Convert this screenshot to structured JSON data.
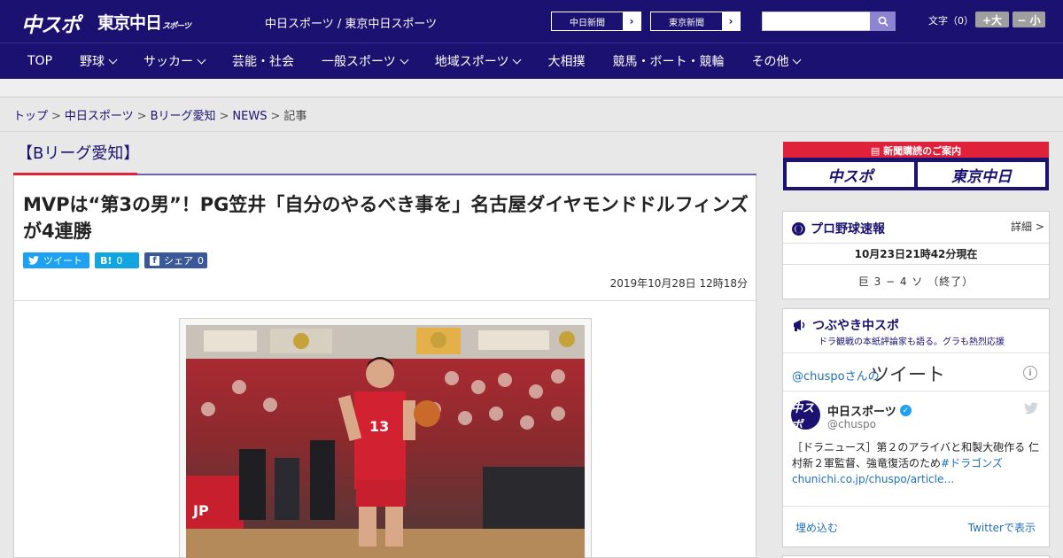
{
  "header": {
    "logo_chuspo": "中スポ",
    "logo_tokyo": "東京中日",
    "logo_tokyo_sub": "スポーツ",
    "site_title": "中日スポーツ / 東京中日スポーツ",
    "links": [
      {
        "label": "中日新聞"
      },
      {
        "label": "東京新聞"
      }
    ],
    "search": {
      "placeholder": "",
      "icon": "search-icon"
    },
    "font_size": {
      "label": "文字（0）",
      "bigger": "+大",
      "smaller": "− 小"
    }
  },
  "nav": {
    "items": [
      {
        "label": "TOP",
        "has_menu": false
      },
      {
        "label": "野球",
        "has_menu": true
      },
      {
        "label": "サッカー",
        "has_menu": true
      },
      {
        "label": "芸能・社会",
        "has_menu": false
      },
      {
        "label": "一般スポーツ",
        "has_menu": true
      },
      {
        "label": "地域スポーツ",
        "has_menu": true
      },
      {
        "label": "大相撲",
        "has_menu": false
      },
      {
        "label": "競馬・ボート・競輪",
        "has_menu": false
      },
      {
        "label": "その他",
        "has_menu": true
      }
    ]
  },
  "breadcrumb": {
    "items": [
      "トップ",
      "中日スポーツ",
      "Bリーグ愛知",
      "NEWS"
    ],
    "current": "記事",
    "separator": ">"
  },
  "article": {
    "section": "【Bリーグ愛知】",
    "title": "MVPは“第3の男”！PG笠井「自分のやるべき事を」名古屋ダイヤモンドドルフィンズが4連勝",
    "share": {
      "tweet": "ツイート",
      "hatena_icon": "B!",
      "hatena_count": "0",
      "facebook_icon": "f",
      "facebook_label": "シェア",
      "facebook_count": "0"
    },
    "date": "2019年10月28日 12時18分",
    "photo": {
      "player_number": "13"
    }
  },
  "sidebar": {
    "subscribe": {
      "title": "新聞購読のご案内",
      "left": "中スポ",
      "right": "東京中日"
    },
    "baseball": {
      "title": "プロ野球速報",
      "detail": "詳細 >",
      "time": "10月23日21時42分現在",
      "score": "巨 3 − 4 ソ （終了）"
    },
    "twitter": {
      "title": "つぶやき中スポ",
      "subtitle": "ドラ観戦の本紙評論家も語る。グラも熱烈応援",
      "header_small": "@chuspoさんの",
      "header_big": "ツイート",
      "name": "中日スポーツ",
      "handle": "@chuspo",
      "text": "［ドラニュース］第２のアライバと和製大砲作る 仁村新２軍監督、強竜復活のため",
      "link": "#ドラゴンズchunichi.co.jp/chuspo/article…",
      "embed": "埋め込む",
      "view": "Twitterで表示"
    }
  },
  "colors": {
    "brand": "#1a1170",
    "accent": "#e0213a",
    "link": "#1d70b8"
  }
}
